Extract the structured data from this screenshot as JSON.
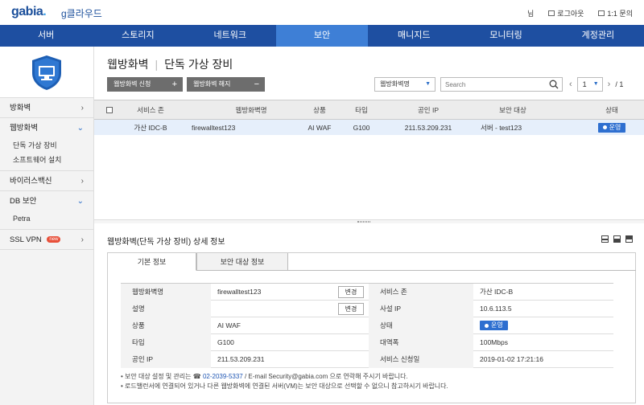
{
  "brand": {
    "logo_main": "gabia",
    "logo_dot": ".",
    "logo_sub": "g클라우드"
  },
  "top_links": {
    "user": "님",
    "logout": "로그아웃",
    "support": "1:1 문의"
  },
  "nav": [
    "서버",
    "스토리지",
    "네트워크",
    "보안",
    "매니지드",
    "모니터링",
    "계정관리"
  ],
  "nav_active": "보안",
  "sidebar": {
    "items": [
      {
        "label": "방화벽",
        "expanded": false
      },
      {
        "label": "웹방화벽",
        "expanded": true,
        "subs": [
          "단독 가상 장비",
          "소프트웨어 설치"
        ]
      },
      {
        "label": "바이러스백신",
        "expanded": false
      },
      {
        "label": "DB 보안",
        "expanded": true,
        "subs": [
          "Petra"
        ]
      },
      {
        "label": "SSL VPN",
        "expanded": false,
        "badge": "new"
      }
    ]
  },
  "page": {
    "title": "웹방화벽",
    "subtitle": "단독 가상 장비",
    "btn_apply": "웹방화벽 신청",
    "btn_apply_sym": "+",
    "btn_cancel": "웹방화벽 해지",
    "btn_cancel_sym": "−",
    "select_value": "웹방화벽명",
    "search_placeholder": "Search",
    "page_current": "1",
    "page_total": "/ 1"
  },
  "table": {
    "headers": [
      "서비스 존",
      "웹방화벽명",
      "상품",
      "타입",
      "공인 IP",
      "보안 대상",
      "상태"
    ],
    "rows": [
      {
        "zone": "가산 IDC-B",
        "name": "firewalltest123",
        "product": "AI WAF",
        "type": "G100",
        "ip": "211.53.209.231",
        "target": "서버 - test123",
        "status": "운영"
      }
    ]
  },
  "detail": {
    "title": "웹방화벽(단독 가상 장비) 상세 정보",
    "tabs": [
      "기본 정보",
      "보안 대상 정보"
    ],
    "rows": [
      {
        "l1": "웹방화벽명",
        "v1": "firewalltest123",
        "btn": "변경",
        "l2": "서비스 존",
        "v2": "가산 IDC-B"
      },
      {
        "l1": "설명",
        "v1": "",
        "btn": "변경",
        "l2": "사설 IP",
        "v2": "10.6.113.5"
      },
      {
        "l1": "상품",
        "v1": "AI WAF",
        "l2": "상태",
        "v2": "운영"
      },
      {
        "l1": "타입",
        "v1": "G100",
        "l2": "대역폭",
        "v2": "100Mbps"
      },
      {
        "l1": "공인 IP",
        "v1": "211.53.209.231",
        "l2": "서비스 신청일",
        "v2": "2019-01-02 17:21:16"
      }
    ],
    "note1_pre": "• 보안 대상 설정 및 관리는 ☎ ",
    "note1_phone": "02-2039-5337",
    "note1_post": " / E-mail Security@gabia.com 으로 연락해 주시기 바랍니다.",
    "note2": "• 로드밸런서에 연결되어 있거나 다른 웹방화벽에 연결된 서버(VM)는 보안 대상으로 선택할 수 없으니 참고하시기 바랍니다."
  },
  "colors": {
    "nav": "#1e4fa1",
    "nav_active": "#3e7fd6",
    "status": "#2e6fd0",
    "selected_row": "#e6effb"
  }
}
